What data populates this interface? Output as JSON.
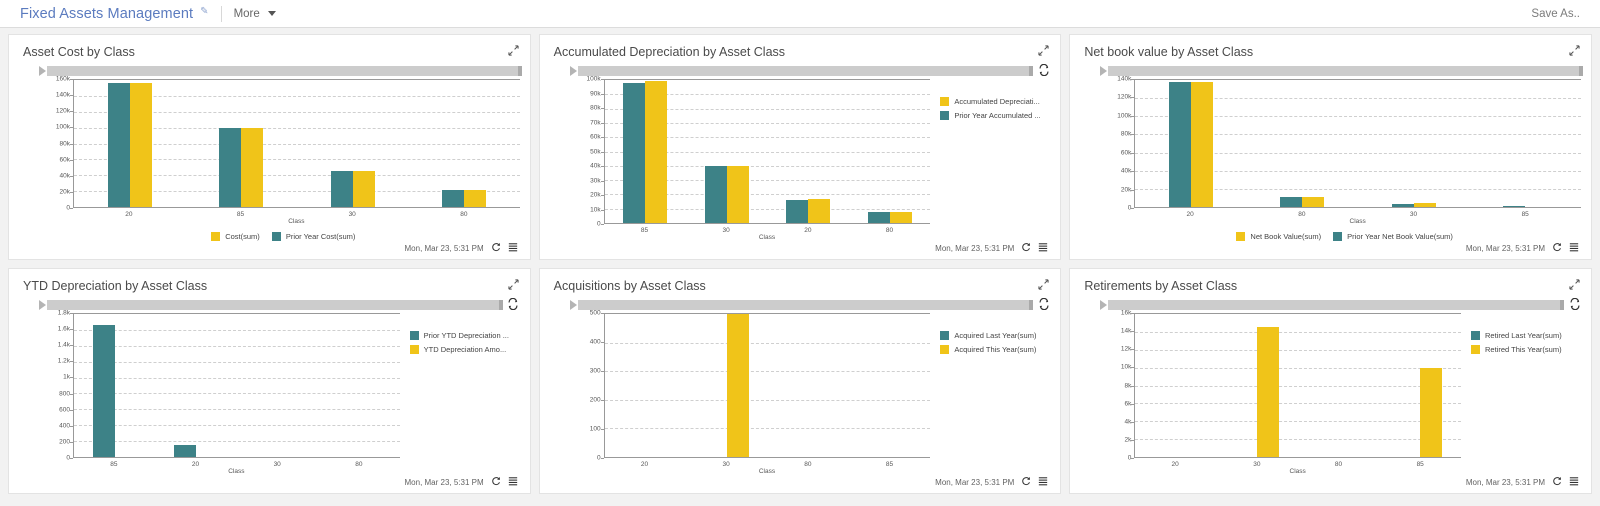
{
  "topbar": {
    "app_title": "Fixed Assets Management",
    "edit_icon": "pencil-icon",
    "more_label": "More",
    "save_as_label": "Save As.."
  },
  "colors": {
    "teal": "#3d8287",
    "yellow": "#f0c419",
    "title_blue": "#5b7bbf"
  },
  "common": {
    "timestamp": "Mon, Mar 23, 5:31 PM",
    "xlabel": "Class"
  },
  "chart_data": [
    {
      "type": "bar",
      "title": "Asset Cost by Class",
      "xlabel": "Class",
      "ylabel": "",
      "categories": [
        "20",
        "85",
        "30",
        "80"
      ],
      "yticks": [
        "0",
        "20k",
        "40k",
        "60k",
        "80k",
        "100k",
        "120k",
        "140k",
        "160k"
      ],
      "ylim": [
        0,
        160000
      ],
      "grid": true,
      "legend_position": "bottom",
      "series": [
        {
          "name": "Prior Year Cost(sum)",
          "color": "teal",
          "values": [
            156000,
            100000,
            45000,
            22000
          ]
        },
        {
          "name": "Cost(sum)",
          "color": "yellow",
          "values": [
            156000,
            100000,
            45000,
            22000
          ]
        }
      ],
      "legend_order": [
        "Cost(sum)",
        "Prior Year Cost(sum)"
      ],
      "timestamp": "Mon, Mar 23, 5:31 PM"
    },
    {
      "type": "bar",
      "title": "Accumulated Depreciation by Asset Class",
      "xlabel": "Class",
      "ylabel": "",
      "categories": [
        "85",
        "30",
        "20",
        "80"
      ],
      "yticks": [
        "0",
        "10k",
        "20k",
        "30k",
        "40k",
        "50k",
        "60k",
        "70k",
        "80k",
        "90k",
        "100k"
      ],
      "ylim": [
        0,
        100000
      ],
      "grid": true,
      "legend_position": "right",
      "series": [
        {
          "name": "Prior Year Accumulated ...",
          "color": "teal",
          "values": [
            98000,
            40000,
            16000,
            8000
          ]
        },
        {
          "name": "Accumulated Depreciati...",
          "color": "yellow",
          "values": [
            99000,
            40000,
            17000,
            8000
          ]
        }
      ],
      "legend_order": [
        "Accumulated Depreciati...",
        "Prior Year Accumulated ..."
      ],
      "timestamp": "Mon, Mar 23, 5:31 PM"
    },
    {
      "type": "bar",
      "title": "Net book value by Asset Class",
      "xlabel": "Class",
      "ylabel": "",
      "categories": [
        "20",
        "80",
        "30",
        "85"
      ],
      "yticks": [
        "0",
        "20k",
        "40k",
        "60k",
        "80k",
        "100k",
        "120k",
        "140k"
      ],
      "ylim": [
        0,
        140000
      ],
      "grid": true,
      "legend_position": "bottom",
      "series": [
        {
          "name": "Prior Year Net Book Value(sum)",
          "color": "teal",
          "values": [
            138000,
            11000,
            3500,
            1500
          ]
        },
        {
          "name": "Net Book Value(sum)",
          "color": "yellow",
          "values": [
            138000,
            11000,
            4000,
            0
          ]
        }
      ],
      "legend_order": [
        "Net Book Value(sum)",
        "Prior Year Net Book Value(sum)"
      ],
      "timestamp": "Mon, Mar 23, 5:31 PM"
    },
    {
      "type": "bar",
      "title": "YTD Depreciation by Asset Class",
      "xlabel": "Class",
      "ylabel": "",
      "categories": [
        "85",
        "20",
        "30",
        "80"
      ],
      "yticks": [
        "0",
        "200",
        "400",
        "600",
        "800",
        "1k",
        "1.2k",
        "1.4k",
        "1.6k",
        "1.8k"
      ],
      "ylim": [
        0,
        1800
      ],
      "grid": true,
      "legend_position": "right",
      "series": [
        {
          "name": "Prior YTD Depreciation ...",
          "color": "teal",
          "values": [
            1660,
            150,
            0,
            0
          ]
        },
        {
          "name": "YTD Depreciation Amo...",
          "color": "yellow",
          "values": [
            0,
            0,
            0,
            0
          ]
        }
      ],
      "legend_order": [
        "Prior YTD Depreciation ...",
        "YTD Depreciation Amo..."
      ],
      "timestamp": "Mon, Mar 23, 5:31 PM"
    },
    {
      "type": "bar",
      "title": "Acquisitions by Asset Class",
      "xlabel": "Class",
      "ylabel": "",
      "categories": [
        "20",
        "30",
        "80",
        "85"
      ],
      "yticks": [
        "0",
        "100",
        "200",
        "300",
        "400",
        "500"
      ],
      "ylim": [
        0,
        500
      ],
      "grid": true,
      "legend_position": "right",
      "series": [
        {
          "name": "Acquired Last Year(sum)",
          "color": "teal",
          "values": [
            0,
            0,
            0,
            0
          ]
        },
        {
          "name": "Acquired This Year(sum)",
          "color": "yellow",
          "values": [
            0,
            500,
            0,
            0
          ]
        }
      ],
      "legend_order": [
        "Acquired Last Year(sum)",
        "Acquired This Year(sum)"
      ],
      "timestamp": "Mon, Mar 23, 5:31 PM"
    },
    {
      "type": "bar",
      "title": "Retirements by Asset Class",
      "xlabel": "Class",
      "ylabel": "",
      "categories": [
        "20",
        "30",
        "80",
        "85"
      ],
      "yticks": [
        "0",
        "2k",
        "4k",
        "6k",
        "8k",
        "10k",
        "12k",
        "14k",
        "16k"
      ],
      "ylim": [
        0,
        16000
      ],
      "grid": true,
      "legend_position": "right",
      "series": [
        {
          "name": "Retired Last Year(sum)",
          "color": "teal",
          "values": [
            0,
            0,
            0,
            0
          ]
        },
        {
          "name": "Retired This Year(sum)",
          "color": "yellow",
          "values": [
            0,
            14500,
            0,
            10000
          ]
        }
      ],
      "legend_order": [
        "Retired Last Year(sum)",
        "Retired This Year(sum)"
      ],
      "timestamp": "Mon, Mar 23, 5:31 PM"
    }
  ]
}
